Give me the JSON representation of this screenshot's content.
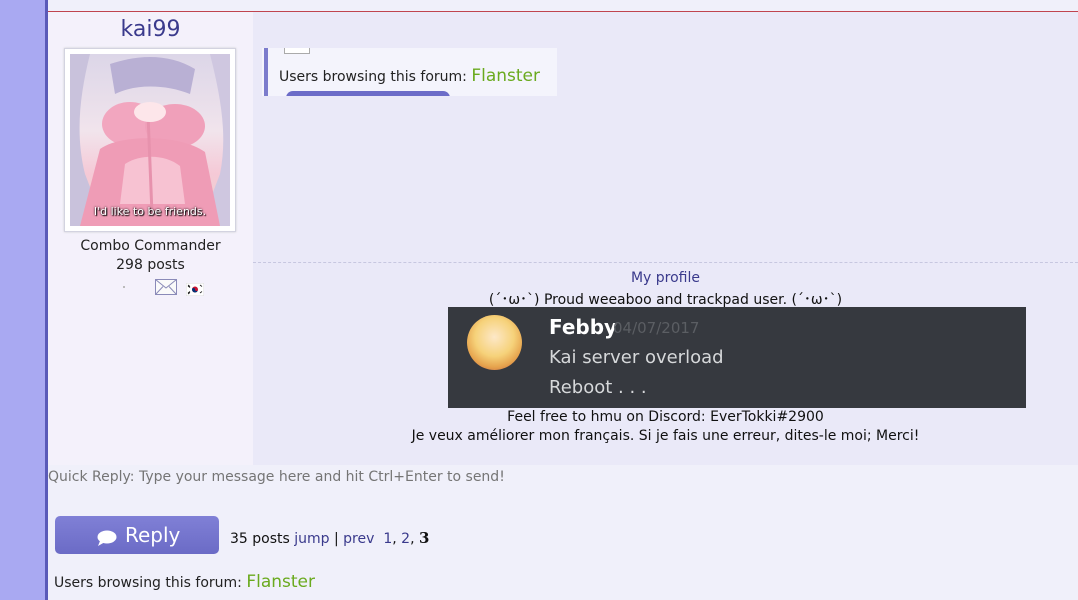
{
  "post": {
    "username": "kai99",
    "avatar_caption": "I'd like to be friends.",
    "rank": "Combo Commander",
    "post_count": "298 posts",
    "icons": {
      "mail": "envelope-icon",
      "flag": "south-korea-flag-icon"
    }
  },
  "quoted_snippet": {
    "label": "Users browsing this forum:",
    "user": "Flanster"
  },
  "signature": {
    "my_profile": "My profile",
    "line1": "(´･ω･`) Proud weeaboo and trackpad user. (´･ω･`)",
    "discord": {
      "name": "Febby",
      "date": "04/07/2017",
      "message1": "Kai server overload",
      "message2": "Reboot . . ."
    },
    "line2": "Feel free to hmu on Discord: EverTokki#2900",
    "line3": "Je veux améliorer mon français. Si je fais une erreur, dites-le moi; Merci!"
  },
  "quick_reply": {
    "placeholder": "Quick Reply: Type your message here and hit Ctrl+Enter to send!"
  },
  "footer": {
    "reply_label": "Reply",
    "post_total": "35 posts",
    "jump": "jump",
    "sep": "|",
    "prev": "prev",
    "pages": [
      "1",
      "2",
      "3"
    ],
    "current_page": "3",
    "browsing_label": "Users browsing this forum:",
    "browsing_user": "Flanster"
  },
  "colors": {
    "accent": "#6b6bc6",
    "link": "#3a3a8c",
    "online_user": "#6aaa1e",
    "discord_bg": "#36393f"
  }
}
